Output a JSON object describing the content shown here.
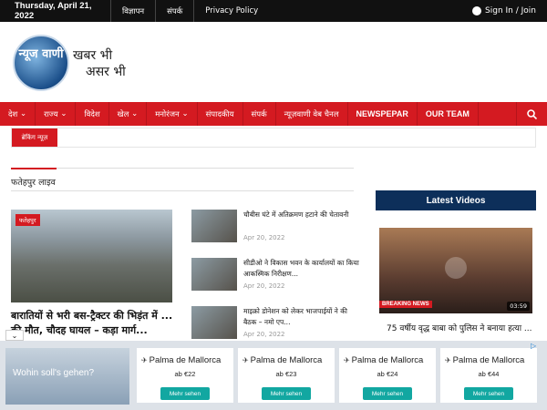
{
  "topbar": {
    "date": "Thursday, April 21, 2022",
    "links": [
      "विज्ञापन",
      "संपर्क",
      "Privacy Policy"
    ],
    "signin": "Sign In / Join"
  },
  "header": {
    "logo_text": "न्यूज वाणी",
    "tagline_line1": "खबर भी",
    "tagline_line2": "असर भी"
  },
  "nav": {
    "items": [
      "देश",
      "राज्य",
      "विदेश",
      "खेल",
      "मनोरंजन",
      "संपादकीय",
      "संपर्क",
      "न्यूज़वाणी वेब चैनल",
      "NEWSPEPAR",
      "OUR TEAM"
    ],
    "search_icon": "search-icon"
  },
  "breaking": {
    "label": "ब्रेकिंग न्यूज़"
  },
  "section": {
    "title": "फतेहपुर लाइव"
  },
  "lead": {
    "tag": "फतेहपुर",
    "title": "बारातियों से भरी बस-ट्रैक्टर की भिड़ंत में ... की मौत, चौदह घायल – कड़ा मार्ग..."
  },
  "side_list": [
    {
      "title": "चौबीस घंटे में अतिक्रमण हटाने की चेतावनी",
      "date": "Apr 20, 2022"
    },
    {
      "title": "सीडीओ ने विकास भवन के कार्यालयों का किया आकस्मिक निरीक्षण...",
      "date": "Apr 20, 2022"
    },
    {
      "title": "माइक्रो डोनेशन को लेकर भाजपाईयों ने की बैठक – नमो एप...",
      "date": "Apr 20, 2022"
    }
  ],
  "videos": {
    "heading": "Latest Videos",
    "overlay": "BREAKING NEWS",
    "duration": "03:59",
    "title": "75 वर्षीय वृद्ध बाबा को पुलिस ने बनाया हत्या ..."
  },
  "ad": {
    "headline": "Wohin soll's gehen?",
    "cards": [
      {
        "dest": "Palma de Mallorca",
        "price": "ab €22",
        "button": "Mehr sehen"
      },
      {
        "dest": "Palma de Mallorca",
        "price": "ab €23",
        "button": "Mehr sehen"
      },
      {
        "dest": "Palma de Mallorca",
        "price": "ab €24",
        "button": "Mehr sehen"
      },
      {
        "dest": "Palma de Mallorca",
        "price": "ab €44",
        "button": "Mehr sehen"
      }
    ],
    "colors": {
      "button": "#12a7a1",
      "nav": "#d41a21",
      "video_head": "#0d2f5a"
    }
  }
}
